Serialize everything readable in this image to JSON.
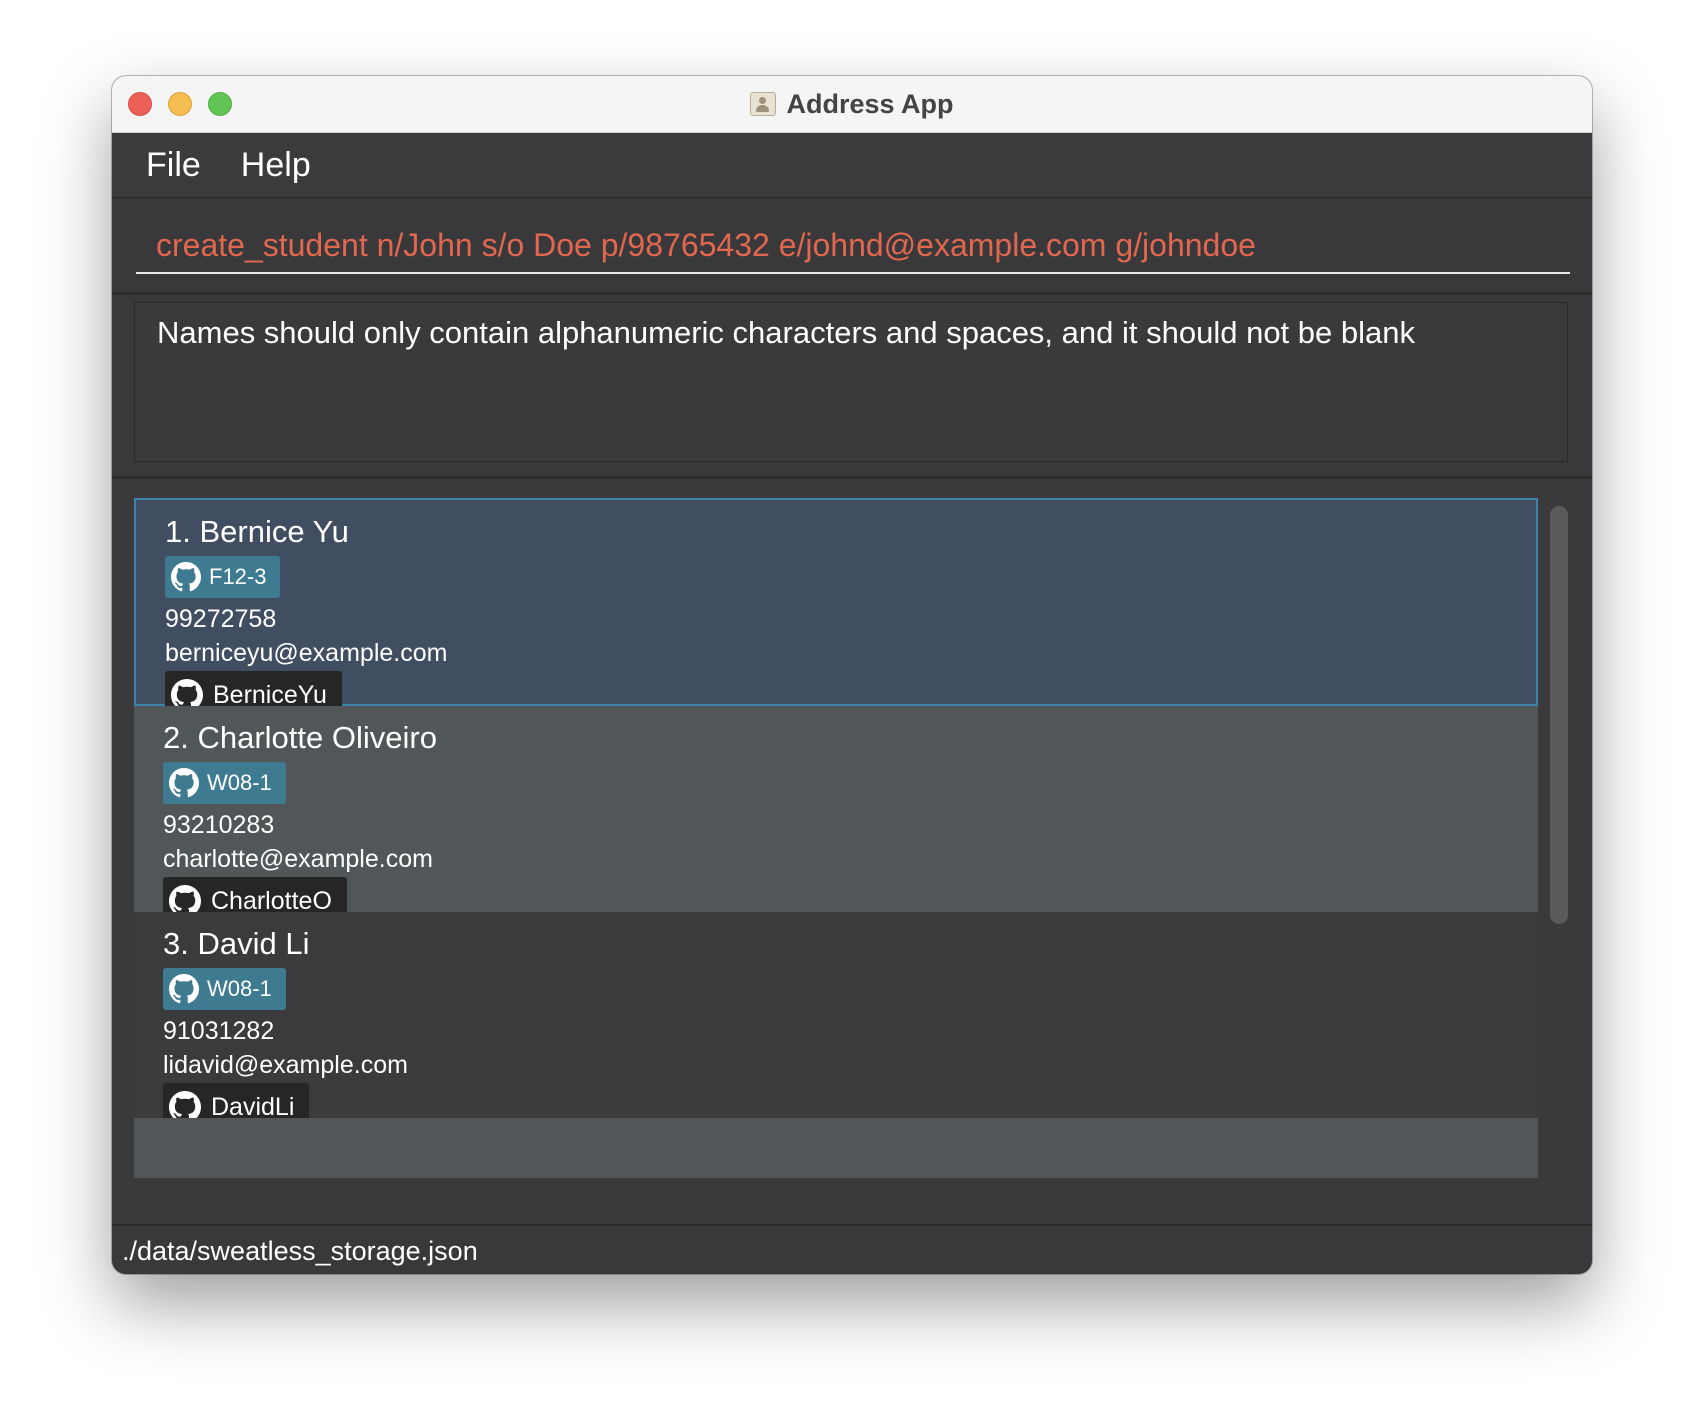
{
  "window": {
    "title": "Address App"
  },
  "menu": {
    "items": [
      "File",
      "Help"
    ]
  },
  "command": {
    "value": "create_student n/John s/o Doe p/98765432 e/johnd@example.com g/johndoe"
  },
  "result": {
    "message": "Names should only contain alphanumeric characters and spaces, and it should not be blank"
  },
  "persons": [
    {
      "index_name": "1. Bernice Yu",
      "group": "F12-3",
      "phone": "99272758",
      "email": "berniceyu@example.com",
      "github": "BerniceYu",
      "selected": true
    },
    {
      "index_name": "2. Charlotte Oliveiro",
      "group": "W08-1",
      "phone": "93210283",
      "email": "charlotte@example.com",
      "github": "CharlotteO",
      "selected": false
    },
    {
      "index_name": "3. David Li",
      "group": "W08-1",
      "phone": "91031282",
      "email": "lidavid@example.com",
      "github": "DavidLi",
      "selected": false
    }
  ],
  "status": {
    "path": "./data/sweatless_storage.json"
  },
  "colors": {
    "command_text": "#e1674f",
    "selected_card": "#414d60",
    "selected_border": "#3d84a8",
    "tag_background": "#3e7b91",
    "github_chip": "#262626"
  },
  "icons": {
    "close": "close-window-icon",
    "minimize": "minimize-window-icon",
    "maximize": "maximize-window-icon",
    "app": "address-book-icon",
    "github": "github-icon"
  }
}
